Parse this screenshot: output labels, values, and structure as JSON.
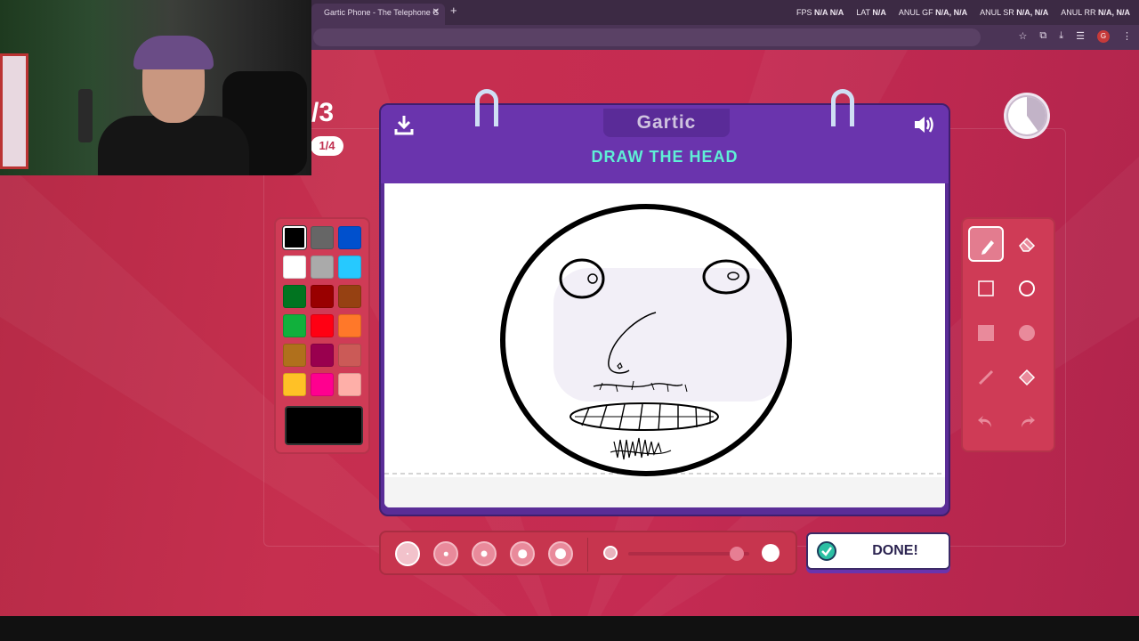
{
  "browser": {
    "tab_title": "Gartic Phone - The Telephone G",
    "tab_close": "✕",
    "new_tab": "+",
    "stats": [
      {
        "label": "FPS",
        "value": "N/A N/A"
      },
      {
        "label": "LAT",
        "value": "N/A"
      },
      {
        "label": "ANUL GF",
        "value": "N/A, N/A"
      },
      {
        "label": "ANUL SR",
        "value": "N/A, N/A"
      },
      {
        "label": "ANUL RR",
        "value": "N/A, N/A"
      }
    ],
    "profile_letter": "G"
  },
  "game": {
    "round_fraction": "/3",
    "round_pill": "1/4",
    "logo_text": "Gartic",
    "prompt": "DRAW THE HEAD",
    "done_label": "DONE!",
    "timer_remaining_fraction": 0.6
  },
  "palette": {
    "colors": [
      "#000000",
      "#666666",
      "#0050cd",
      "#ffffff",
      "#aaaaaa",
      "#26c9ff",
      "#017420",
      "#990000",
      "#964112",
      "#11b03c",
      "#ff0013",
      "#ff7829",
      "#b0701c",
      "#99004e",
      "#cb5a57",
      "#ffc126",
      "#ff008f",
      "#feafa8"
    ],
    "selected_color": "#000000"
  },
  "tools": [
    {
      "name": "pen-tool",
      "icon": "pencil-icon",
      "active": true
    },
    {
      "name": "eraser-tool",
      "icon": "eraser-icon",
      "active": false
    },
    {
      "name": "rectangle-tool",
      "icon": "square-outline-icon",
      "active": false
    },
    {
      "name": "ellipse-tool",
      "icon": "circle-outline-icon",
      "active": false
    },
    {
      "name": "filled-rectangle-tool",
      "icon": "square-filled-icon",
      "active": false
    },
    {
      "name": "filled-ellipse-tool",
      "icon": "circle-filled-icon",
      "active": false
    },
    {
      "name": "line-tool",
      "icon": "line-icon",
      "active": false
    },
    {
      "name": "fill-tool",
      "icon": "bucket-icon",
      "active": false
    },
    {
      "name": "undo-tool",
      "icon": "undo-icon",
      "active": false
    },
    {
      "name": "redo-tool",
      "icon": "redo-icon",
      "active": false
    }
  ],
  "brush_sizes": {
    "count": 5,
    "selected_index": 0
  },
  "opacity": {
    "value": 0.9
  }
}
